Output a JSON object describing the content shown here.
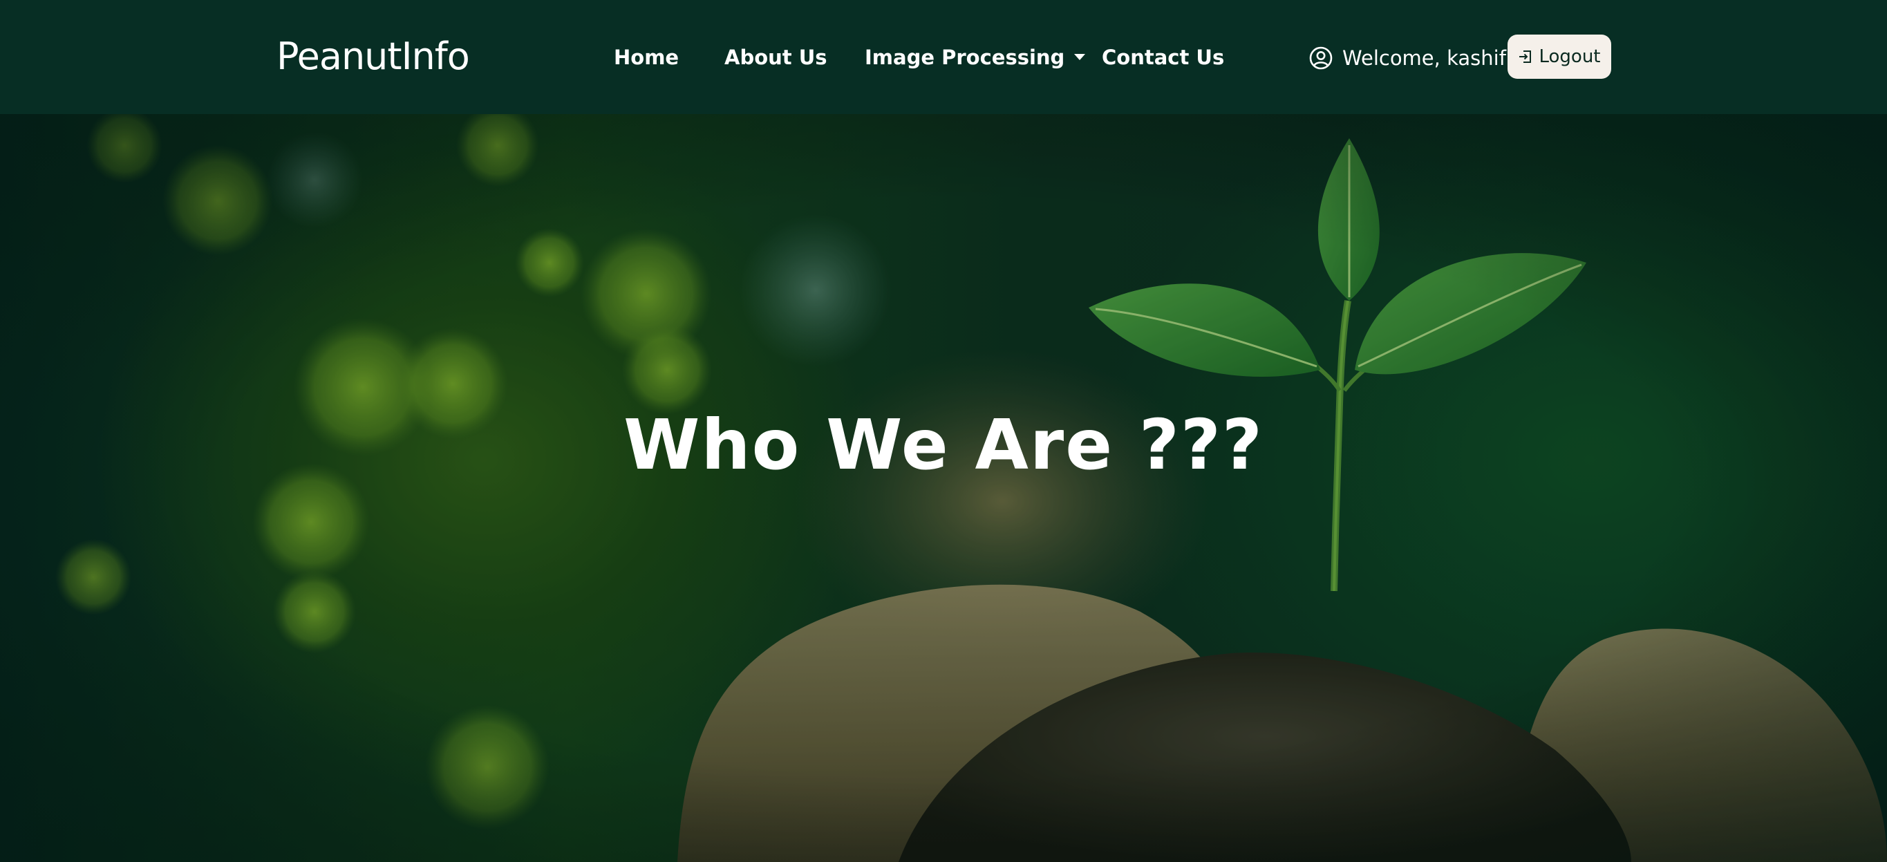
{
  "navbar": {
    "brand": "PeanutInfo",
    "links": {
      "home": "Home",
      "about": "About Us",
      "image_processing": "Image Processing",
      "contact": "Contact Us"
    },
    "welcome_text": "Welcome, kashif",
    "user_icon": "user-circle-icon",
    "logout_label": "Logout",
    "logout_icon": "box-arrow-in-right-icon"
  },
  "hero": {
    "title": "Who We Are ???",
    "image": "seedling-in-soil-held-in-hands"
  },
  "colors": {
    "navbar_bg": "#072e24",
    "logout_bg": "#f5f0ea",
    "text": "#ffffff"
  }
}
